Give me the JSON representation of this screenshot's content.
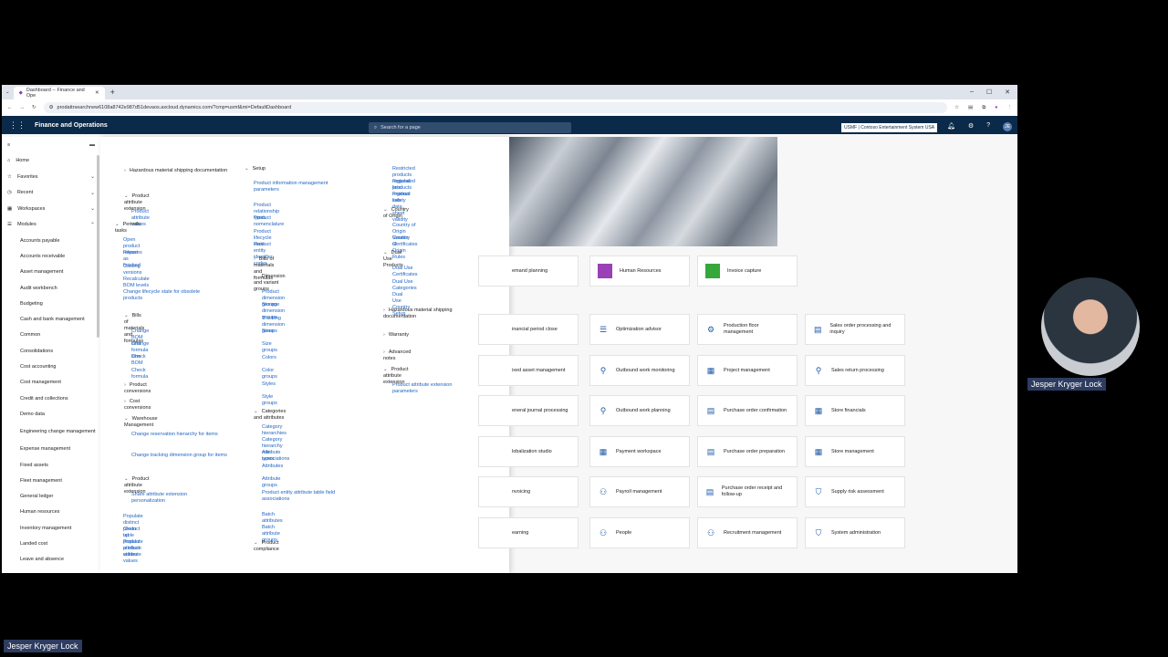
{
  "browser": {
    "tab_title": "Dashboard -- Finance and Ope",
    "url": "prodattrsearchnew6108a8742e987d51devaos.axcloud.dynamics.com/?cmp=usmf&mi=DefaultDashboard"
  },
  "app": {
    "title": "Finance and Operations",
    "search_placeholder": "Search for a page",
    "company": "USMF | Contoso Entertainment System USA",
    "user_initials": "JE"
  },
  "nav": {
    "home": "Home",
    "favorites": "Favorites",
    "recent": "Recent",
    "workspaces": "Workspaces",
    "modules": "Modules",
    "module_items": [
      "Accounts payable",
      "Accounts receivable",
      "Asset management",
      "Audit workbench",
      "Budgeting",
      "Cash and bank management",
      "Common",
      "Consolidations",
      "Cost accounting",
      "Cost management",
      "Credit and collections",
      "Demo data",
      "Engineering change management",
      "Expense management",
      "Fixed assets",
      "Fleet management",
      "General ledger",
      "Human resources",
      "Inventory management",
      "Landed cost",
      "Leave and absence"
    ]
  },
  "flyout": {
    "c1": {
      "hazardous": "Hazardous material shipping documentation",
      "pae1": "Product attribute extension",
      "pav": "Product attribute values",
      "periodic": "Periodic tasks",
      "opr": "Open product releases",
      "raf": "Report as finished",
      "cv": "Costing versions",
      "rbl": "Recalculate BOM levels",
      "cls": "Change lifecycle state for obsolete products",
      "bmf": "Bills of materials and formulas",
      "cbi": "Change BOM item",
      "cfi": "Change formula item",
      "chb": "Check BOM",
      "chf": "Check formula",
      "pc": "Product conversions",
      "cc": "Cost conversions",
      "wm": "Warehouse Management",
      "crh": "Change reservation hierarchy for items",
      "ctd": "Change tracking dimension group for items",
      "pae2": "Product attribute extension",
      "sae": "Share attribute extension personalization",
      "pdp": "Populate distinct product table",
      "cup": "Clean up product attribute values",
      "ppa": "Populate product attribute values"
    },
    "c2": {
      "setup": "Setup",
      "pimp": "Product information management parameters",
      "prt": "Product relationship types",
      "pn": "Product nomenclature",
      "pls": "Product lifecycle state",
      "pic": "Product entity identifier codes",
      "bmf": "Bills of materials and formulas",
      "dvg": "Dimension and variant groups",
      "pdg": "Product dimension groups",
      "sdg": "Storage dimension groups",
      "tdg": "Tracking dimension groups",
      "sizes": "Sizes",
      "sizeg": "Size groups",
      "colors": "Colors",
      "colorg": "Color groups",
      "styles": "Styles",
      "styleg": "Style groups",
      "ca": "Categories and attributes",
      "ch": "Category hierarchies",
      "chra": "Category hierarchy role associations",
      "at": "Attribute types",
      "attrs": "Attributes",
      "ag": "Attribute groups",
      "petf": "Product entity attribute table field associations",
      "ba": "Batch attributes",
      "bag": "Batch attribute groups",
      "pcomp": "Product compliance"
    },
    "c3": {
      "rprl": "Restricted products regional lists",
      "rgrl": "Regulated products regional lists",
      "psds": "Product safety data sheet validity",
      "coo": "Country of Origin",
      "coovc": "Country of Origin Vendor Certificates",
      "coor": "Country of Origin Rules",
      "dup": "Dual Use Products",
      "duc": "Dual Use Certificates",
      "ducat": "Dual Use Categories",
      "ducs": "Dual Use Country Setup",
      "hms": "Hazardous material shipping documentation",
      "war": "Warranty",
      "an": "Advanced notes",
      "pae": "Product attribute extension",
      "paep": "Product attribute extension parameters"
    }
  },
  "tiles": {
    "demand": "emand planning",
    "hr": "Human Resources",
    "invoice": "Invoice capture",
    "fpc": "inancial period close",
    "opt": "Optimization advisor",
    "pfm": "Production floor management",
    "sop": "Sales order processing and inquiry",
    "fam": "ixed asset management",
    "owm": "Outbound work monitoring",
    "pm": "Project management",
    "srp": "Sales return processing",
    "gjp": "eneral journal processing",
    "owp": "Outbound work planning",
    "poc": "Purchase order confirmation",
    "sf": "Store financials",
    "gs": "lobalization studio",
    "pw": "Payment workspace",
    "pop": "Purchase order preparation",
    "sm": "Store management",
    "inv": "nvoicing",
    "payroll": "Payroll management",
    "por": "Purchase order receipt and follow-up",
    "sra": "Supply risk assessment",
    "learn": "earning",
    "people": "People",
    "rm": "Recruitment management",
    "sa": "System administration"
  },
  "presenter": {
    "name": "Jesper Kryger Lock"
  }
}
